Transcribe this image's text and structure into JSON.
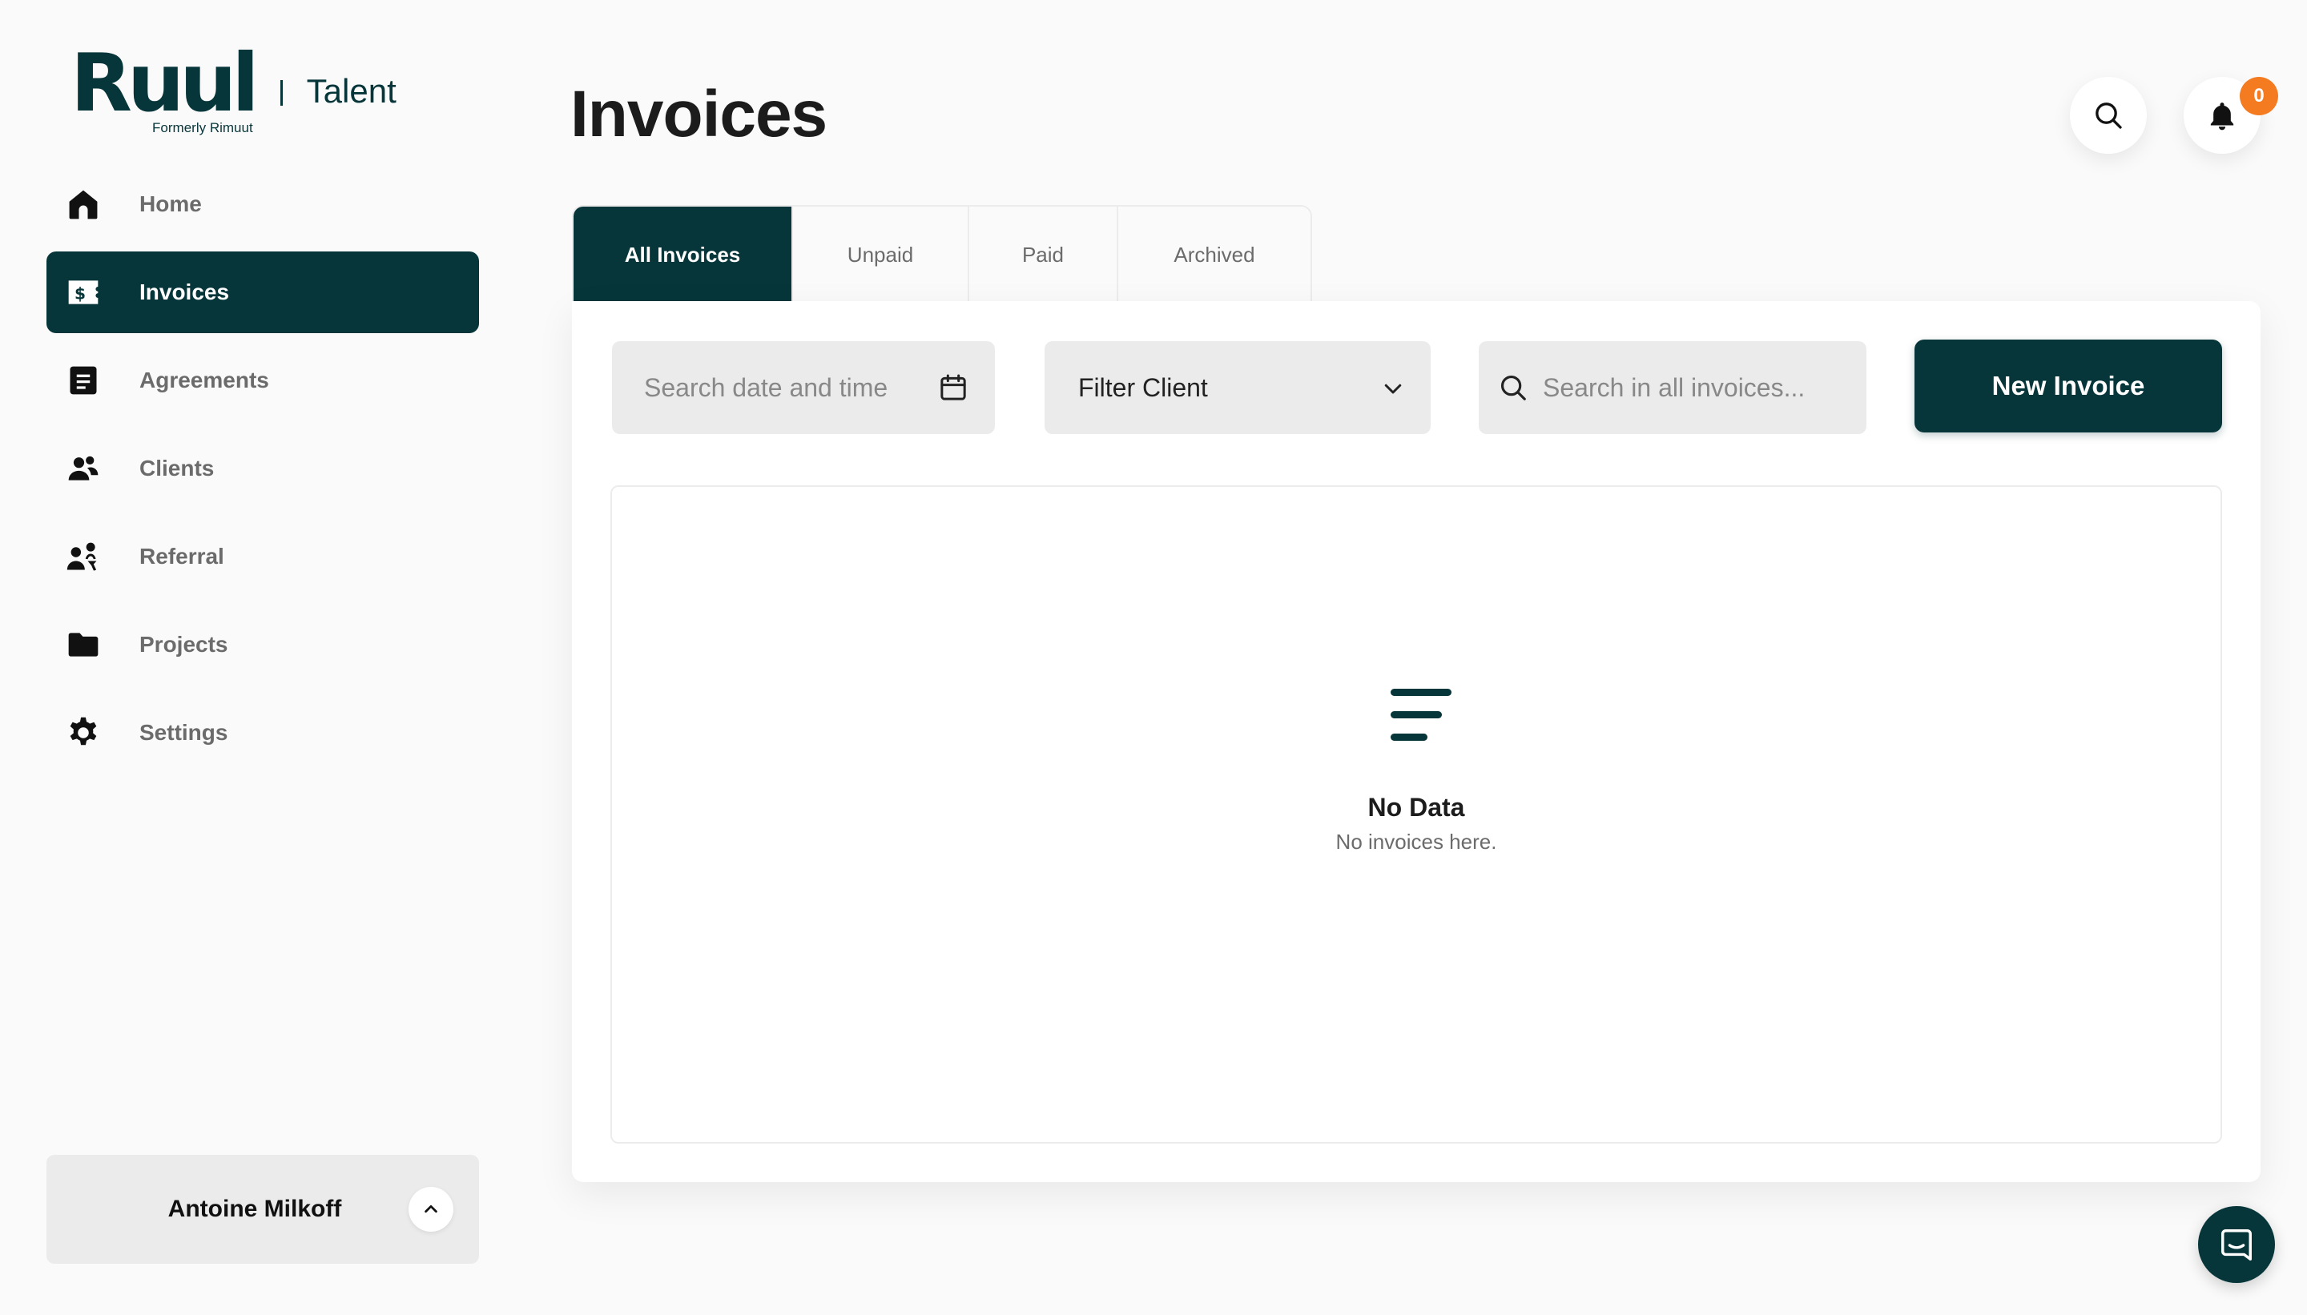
{
  "brand": {
    "logo_text": "Ruul",
    "logo_subtitle": "Formerly Rimuut",
    "product": "Talent",
    "primary_color": "#06363a",
    "badge_color": "#f47b20"
  },
  "sidebar": {
    "items": [
      {
        "label": "Home",
        "icon": "home-icon",
        "active": false
      },
      {
        "label": "Invoices",
        "icon": "invoice-icon",
        "active": true
      },
      {
        "label": "Agreements",
        "icon": "document-icon",
        "active": false
      },
      {
        "label": "Clients",
        "icon": "users-icon",
        "active": false
      },
      {
        "label": "Referral",
        "icon": "referral-icon",
        "active": false
      },
      {
        "label": "Projects",
        "icon": "folder-icon",
        "active": false
      },
      {
        "label": "Settings",
        "icon": "gear-icon",
        "active": false
      }
    ],
    "user": {
      "name": "Antoine Milkoff"
    }
  },
  "header": {
    "title": "Invoices",
    "notifications_count": "0"
  },
  "tabs": [
    {
      "label": "All Invoices",
      "active": true
    },
    {
      "label": "Unpaid",
      "active": false
    },
    {
      "label": "Paid",
      "active": false
    },
    {
      "label": "Archived",
      "active": false
    }
  ],
  "filters": {
    "date_placeholder": "Search date and time",
    "client_filter": "Filter Client",
    "search_placeholder": "Search in all invoices..."
  },
  "actions": {
    "new_invoice": "New Invoice"
  },
  "empty_state": {
    "title": "No Data",
    "subtitle": "No invoices here."
  }
}
